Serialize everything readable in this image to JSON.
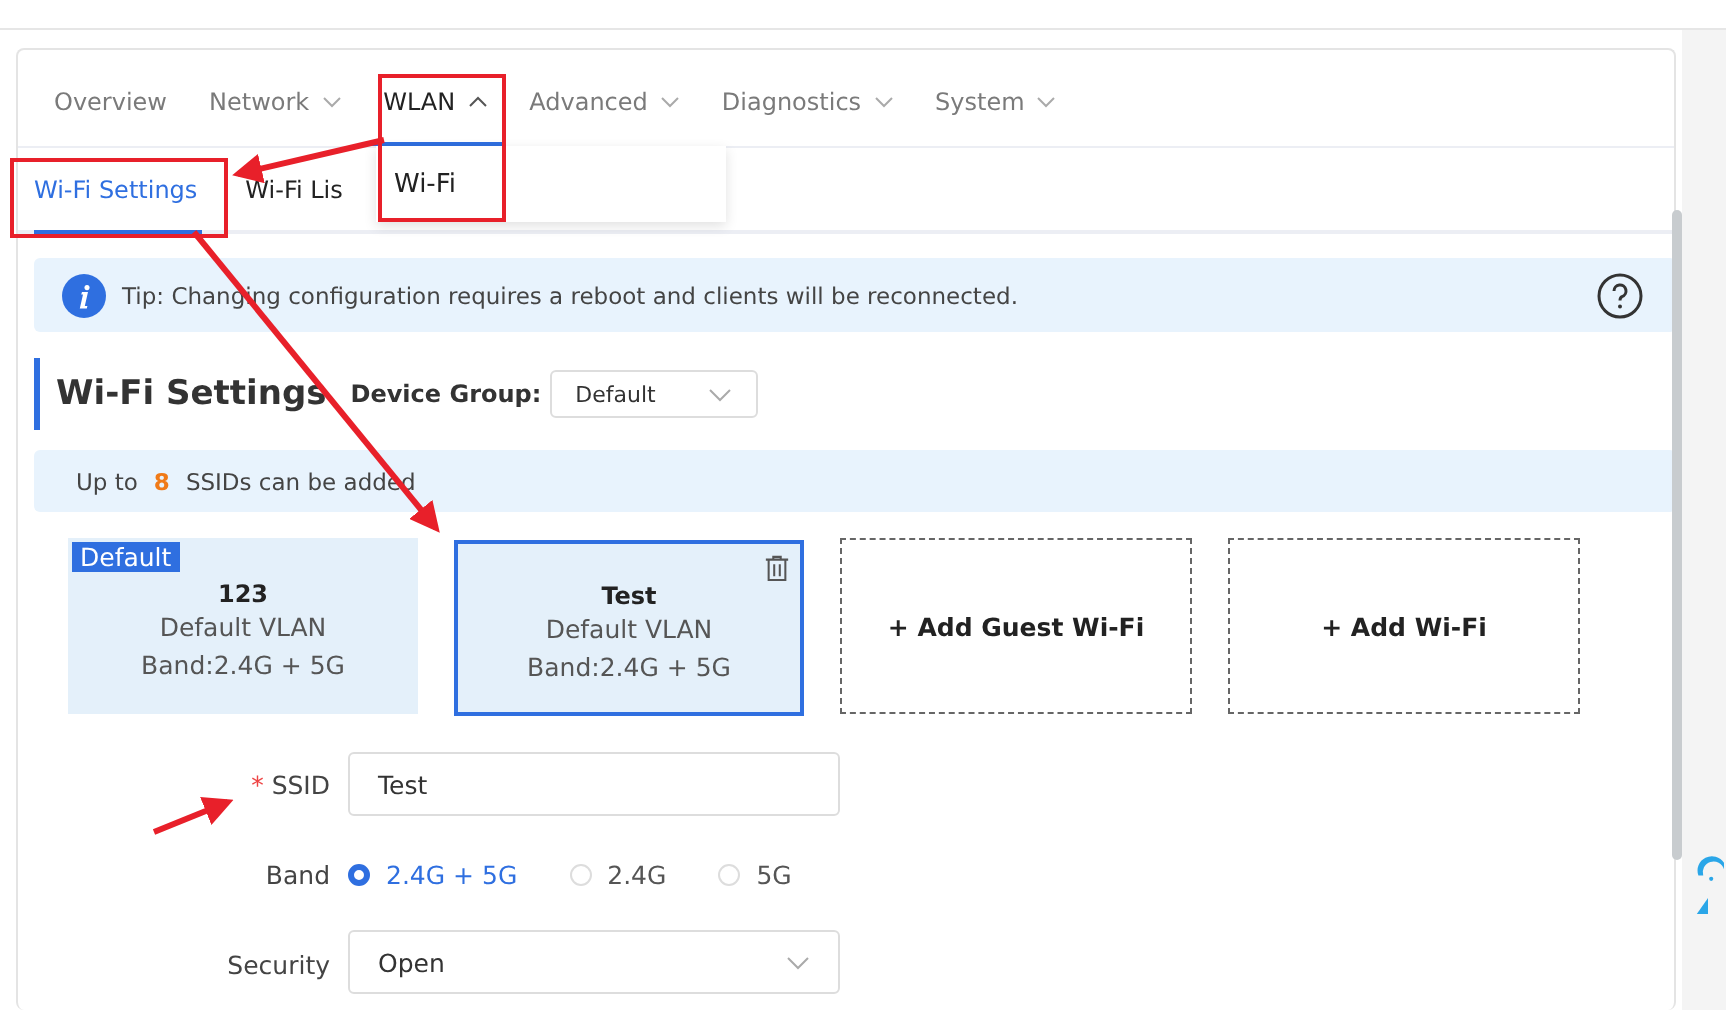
{
  "nav": [
    {
      "label": "Overview",
      "selected": false
    },
    {
      "label": "Network",
      "expanded": false,
      "selected": false
    },
    {
      "label": "WLAN",
      "expanded": true,
      "selected": true
    },
    {
      "label": "Advanced",
      "expanded": false,
      "selected": false
    },
    {
      "label": "Diagnostics",
      "expanded": false,
      "selected": false
    },
    {
      "label": "System",
      "expanded": false,
      "selected": false
    }
  ],
  "dropdown": {
    "items": [
      "Wi-Fi"
    ]
  },
  "subtabs": [
    {
      "label": "Wi-Fi Settings",
      "selected": true
    },
    {
      "label": "Wi-Fi Lis",
      "selected": false
    }
  ],
  "tip": {
    "text": "Tip: Changing configuration requires a reboot and clients will be reconnected."
  },
  "section": {
    "title": "Wi-Fi Settings",
    "group_label": "Device Group:",
    "group_value": "Default"
  },
  "limit": {
    "prefix": "Up to",
    "count": "8",
    "suffix": "SSIDs can be added"
  },
  "cards": [
    {
      "kind": "wifi",
      "badge": "Default",
      "name": "123",
      "vlan": "Default VLAN",
      "band": "Band:2.4G + 5G",
      "selected": false,
      "deletable": false
    },
    {
      "kind": "wifi",
      "name": "Test",
      "vlan": "Default VLAN",
      "band": "Band:2.4G + 5G",
      "selected": true,
      "deletable": true
    },
    {
      "kind": "add",
      "label": "+ Add Guest Wi-Fi"
    },
    {
      "kind": "add",
      "label": "+ Add Wi-Fi"
    }
  ],
  "form": {
    "ssid": {
      "label": "SSID",
      "required_mark": "*",
      "value": "Test"
    },
    "band": {
      "label": "Band",
      "options": [
        {
          "label": "2.4G + 5G",
          "selected": true
        },
        {
          "label": "2.4G",
          "selected": false
        },
        {
          "label": "5G",
          "selected": false
        }
      ]
    },
    "security": {
      "label": "Security",
      "value": "Open"
    }
  }
}
